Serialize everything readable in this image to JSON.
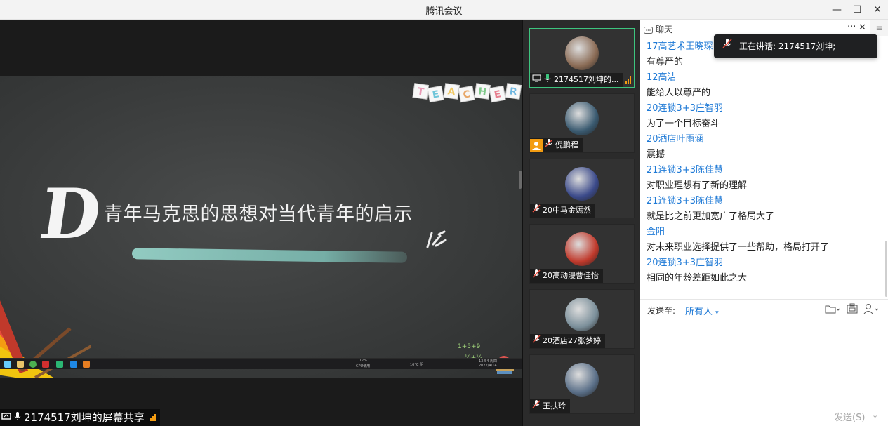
{
  "window": {
    "title": "腾讯会议",
    "minimize": "—",
    "maximize": "☐",
    "close": "✕"
  },
  "share": {
    "slide_title": "青年马克思的思想对当代青年的启示",
    "big_letter": "D",
    "teacher_letters": [
      "T",
      "E",
      "A",
      "C",
      "H",
      "E",
      "R"
    ],
    "label": "2174517刘坤的屏幕共享",
    "taskbar_cpu": "17%",
    "taskbar_cpu_label": "CPU使用",
    "taskbar_temp": "16°C 阴",
    "taskbar_time": "13:54 周四",
    "taskbar_date": "2022/4/14"
  },
  "participants": [
    {
      "name": "2174517刘坤的...",
      "active": true,
      "mic_on": true,
      "avatar_color": "#8a6b55"
    },
    {
      "name": "倪鹏程",
      "active": false,
      "mic_on": false,
      "avatar_color": "#3a5a70"
    },
    {
      "name": "20中马金嫣然",
      "active": false,
      "mic_on": false,
      "avatar_color": "#3b4a8a"
    },
    {
      "name": "20高动漫曹佳怡",
      "active": false,
      "mic_on": false,
      "avatar_color": "#c0392b"
    },
    {
      "name": "20酒店27张梦婷",
      "active": false,
      "mic_on": false,
      "avatar_color": "#7b8f9a"
    },
    {
      "name": "王扶玲",
      "active": false,
      "mic_on": false,
      "avatar_color": "#5a6f88"
    }
  ],
  "chat": {
    "header": "聊天",
    "more": "···",
    "close": "✕",
    "messages": [
      {
        "sender": "17高艺术王晓琛",
        "text": "有尊严的"
      },
      {
        "sender": "12高洁",
        "text": "能给人以尊严的"
      },
      {
        "sender": "20连锁3+3庄智羽",
        "text": "为了一个目标奋斗"
      },
      {
        "sender": "20酒店叶雨涵",
        "text": "震撼"
      },
      {
        "sender": "21连锁3+3陈佳慧",
        "text": "对职业理想有了新的理解"
      },
      {
        "sender": "21连锁3+3陈佳慧",
        "text": "就是比之前更加宽广了格局大了"
      },
      {
        "sender": "金阳",
        "text": "对未来职业选择提供了一些帮助，格局打开了"
      },
      {
        "sender": "20连锁3+3庄智羽",
        "text": "相同的年龄差距如此之大"
      }
    ],
    "send_to_label": "发送至:",
    "send_to_target": "所有人",
    "send_button": "发送(S)",
    "speaking_text": "正在讲话: 2174517刘坤;"
  },
  "colors": {
    "accent": "#1f7ad6",
    "active_border": "#3dc47e",
    "signal": "#f39c12"
  }
}
